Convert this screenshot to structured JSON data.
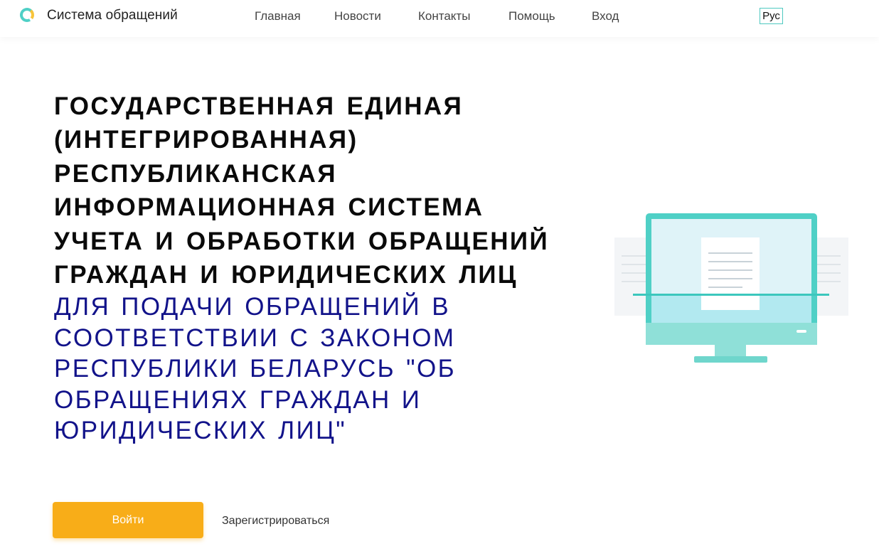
{
  "header": {
    "brand": "Система обращений",
    "nav": [
      "Главная",
      "Новости",
      "Контакты",
      "Помощь",
      "Вход"
    ],
    "language": "Рус"
  },
  "hero": {
    "title": "Государственная единая (интегрированная) республиканская информационная система учета и обработки обращений граждан и юридических лиц",
    "subtitle": "для подачи обращений в соответствии с Законом Республики Беларусь \"Об обращениях граждан и юридических лиц\""
  },
  "actions": {
    "login_label": "Войти",
    "register_label": "Зарегистрироваться"
  },
  "colors": {
    "accent": "#f8ad18",
    "teal": "#4fd0c6",
    "subtitle": "#12138a"
  },
  "icons": {
    "logo": "logo-icon",
    "illustration": "computer-monitor-illustration"
  }
}
